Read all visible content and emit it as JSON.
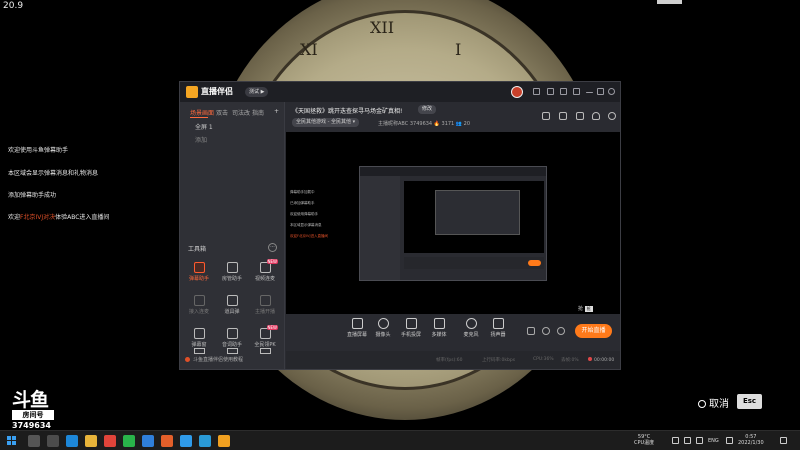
{
  "overlay": {
    "fps": "20.9"
  },
  "notices": [
    {
      "text": "欢迎使用斗鱼弹幕助手"
    },
    {
      "text": "本区域会显示弹幕消息和礼物消息"
    },
    {
      "text": "添加弹幕助手成功"
    },
    {
      "pre": "欢迎",
      "highlight": "F北京IVJ对决",
      "post": "体验ABC进入直播间"
    }
  ],
  "app": {
    "brand": "直播伴侣",
    "version_badge": "测试 ▶",
    "sidebar": {
      "tabs": [
        "场景画面",
        "双击",
        "司法改",
        "指南"
      ],
      "add": "+",
      "scene_name": "全屏 1",
      "scene_item": "添加",
      "toolbox_title": "工具箱",
      "toolbox_more": "···",
      "tools": [
        {
          "label": "弹幕助手",
          "icon": "danmaku-icon",
          "state": "hot"
        },
        {
          "label": "房管助手",
          "icon": "admin-icon",
          "state": "normal"
        },
        {
          "label": "视频连麦",
          "icon": "video-link-icon",
          "state": "normal",
          "badge": "NEW"
        },
        {
          "label": "接入连麦",
          "icon": "connect-icon",
          "state": "dim"
        },
        {
          "label": "道具弹",
          "icon": "gift-icon",
          "state": "normal"
        },
        {
          "label": "主播开播",
          "icon": "broadcast-icon",
          "state": "dim"
        },
        {
          "label": "弹幕窗",
          "icon": "comment-window-icon",
          "state": "normal"
        },
        {
          "label": "音词助手",
          "icon": "keyword-icon",
          "state": "normal"
        },
        {
          "label": "全民领PK",
          "icon": "pk-icon",
          "state": "normal",
          "badge": "NEW"
        },
        {
          "label": "",
          "icon": "triangle-icon",
          "state": "normal"
        },
        {
          "label": "",
          "icon": "triangle-icon",
          "state": "normal"
        },
        {
          "label": "",
          "icon": "triangle-icon",
          "state": "normal"
        }
      ],
      "footer": "斗鱼直播伴侣使用教程"
    },
    "room": {
      "title": "《天国拯救》跳开迭查探寻马场金矿真相!",
      "edit": "修改",
      "category": "全民其他游戏 - 全民其他 ▾",
      "meta": "主播昵称ABC   3749634    🔥 3171    👥 20"
    },
    "preview": {
      "left_text": [
        "弹幕助手加载中",
        "已添加弹幕助手",
        "欢迎使用弹幕助手",
        "本区域显示弹幕消息",
        "欢迎F北京IVJ进入直播间"
      ],
      "badge": "抢",
      "badge_box": "抢"
    },
    "controls": [
      {
        "label": "直播屏幕",
        "icon": "screen-icon"
      },
      {
        "label": "摄像头",
        "icon": "camera-icon"
      },
      {
        "label": "手机投屏",
        "icon": "phone-cast-icon"
      },
      {
        "label": "多媒体",
        "icon": "media-icon"
      },
      {
        "label": "麦克风",
        "icon": "mic-icon"
      },
      {
        "label": "扬声器",
        "icon": "speaker-icon"
      }
    ],
    "live_button": "开始直播",
    "status": {
      "fps": "帧率(fps):60",
      "bitrate": "上行码率:0kbps",
      "cpu": "CPU:36%",
      "loss": "丢帧:0%",
      "time": "00:00:00"
    }
  },
  "brand_mark": {
    "logo": "斗鱼",
    "room_label": "房间号",
    "room_id": "3749634"
  },
  "cancel": {
    "label": "取消",
    "key": "Esc"
  },
  "taskbar": {
    "weather_temp": "59°C",
    "weather_label": "CPU温度",
    "lang": "ENG",
    "time": "0:57",
    "date": "2022/1/30",
    "apps": [
      {
        "name": "search-app",
        "color": "#555555"
      },
      {
        "name": "task-view-app",
        "color": "#4c4c4c"
      },
      {
        "name": "edge-app",
        "color": "#1d87d8"
      },
      {
        "name": "explorer-app",
        "color": "#e8b43a"
      },
      {
        "name": "chrome-app",
        "color": "#e0443a"
      },
      {
        "name": "wechat-app",
        "color": "#29b34a"
      },
      {
        "name": "wechat-work-app",
        "color": "#2f7fdb"
      },
      {
        "name": "douyu-app",
        "color": "#e35f2a"
      },
      {
        "name": "qq-app",
        "color": "#2f9bea"
      },
      {
        "name": "photos-app",
        "color": "#2a9ad6"
      },
      {
        "name": "companion-app",
        "color": "#f0a020"
      }
    ]
  }
}
